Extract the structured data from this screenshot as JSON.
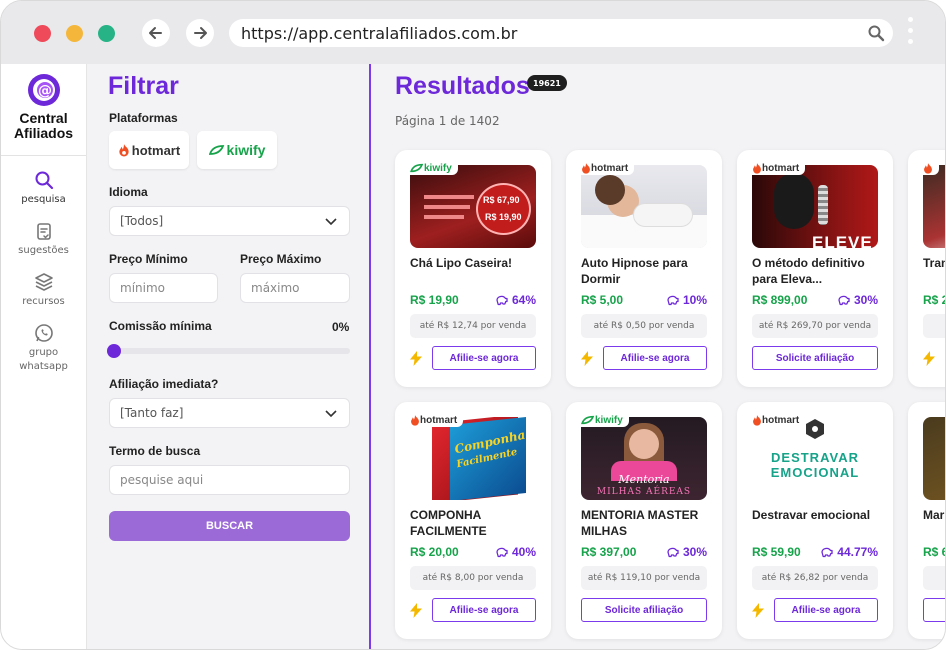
{
  "browser": {
    "url": "https://app.centralafiliados.com.br"
  },
  "sidebar": {
    "logo_line1": "Central",
    "logo_line2": "Afiliados",
    "items": [
      {
        "label": "pesquisa",
        "icon": "search-icon"
      },
      {
        "label": "sugestões",
        "icon": "clipboard-check-icon"
      },
      {
        "label": "recursos",
        "icon": "layers-icon"
      },
      {
        "label": "grupo whatsapp",
        "icon": "whatsapp-icon"
      }
    ]
  },
  "filter": {
    "title": "Filtrar",
    "platforms_label": "Plataformas",
    "platforms": [
      "hotmart",
      "kiwify"
    ],
    "language_label": "Idioma",
    "language_value": "[Todos]",
    "min_price_label": "Preço Mínimo",
    "min_price_placeholder": "mínimo",
    "max_price_label": "Preço Máximo",
    "max_price_placeholder": "máximo",
    "commission_label": "Comissão mínima",
    "commission_value": "0%",
    "commission_fraction": 0,
    "affiliation_label": "Afiliação imediata?",
    "affiliation_value": "[Tanto faz]",
    "search_label": "Termo de busca",
    "search_placeholder": "pesquise aqui",
    "search_button": "BUSCAR"
  },
  "results": {
    "title": "Resultados",
    "count": "19621",
    "page": "Página 1 de 1402",
    "cards": [
      {
        "platform": "kiwify",
        "title": "Chá Lipo Caseira!",
        "price": "R$ 19,90",
        "commission": "64%",
        "per_sale": "até R$ 12,74 por venda",
        "action": "Afilie-se agora",
        "instant": true,
        "thumb_text": [
          "R$ 67,90",
          "R$ 19,90"
        ]
      },
      {
        "platform": "hotmart",
        "title": "Auto Hipnose para Dormir",
        "price": "R$ 5,00",
        "commission": "10%",
        "per_sale": "até R$ 0,50 por venda",
        "action": "Afilie-se agora",
        "instant": true,
        "thumb_text": []
      },
      {
        "platform": "hotmart",
        "title": "O método definitivo para Eleva...",
        "price": "R$ 899,00",
        "commission": "30%",
        "per_sale": "até R$ 269,70 por venda",
        "action": "Solicite afiliação",
        "instant": false,
        "thumb_text": [
          "ELEVE"
        ]
      },
      {
        "platform": "hotmart",
        "title": "COMPONHA FACILMENTE",
        "price": "R$ 20,00",
        "commission": "40%",
        "per_sale": "até R$ 8,00 por venda",
        "action": "Afilie-se agora",
        "instant": true,
        "thumb_text": [
          "Componha",
          "Facilmente"
        ]
      },
      {
        "platform": "kiwify",
        "title": "MENTORIA MASTER MILHAS",
        "price": "R$ 397,00",
        "commission": "30%",
        "per_sale": "até R$ 119,10 por venda",
        "action": "Solicite afiliação",
        "instant": false,
        "thumb_text": [
          "Mentoria",
          "MILHAS AÉREAS"
        ]
      },
      {
        "platform": "hotmart",
        "title": "Destravar emocional",
        "price": "R$ 59,90",
        "commission": "44.77%",
        "per_sale": "até R$ 26,82 por venda",
        "action": "Afilie-se agora",
        "instant": true,
        "thumb_text": [
          "DESTRAVAR",
          "EMOCIONAL"
        ]
      }
    ],
    "partial_cards": [
      {
        "title": "Tran",
        "price": "R$ 2"
      },
      {
        "title": "Mar - M",
        "price": "R$ 6"
      }
    ]
  },
  "colors": {
    "brand": "#6d28d9",
    "price": "#16a34a",
    "hotmart": "#f04e23",
    "kiwify": "#16a34a"
  }
}
